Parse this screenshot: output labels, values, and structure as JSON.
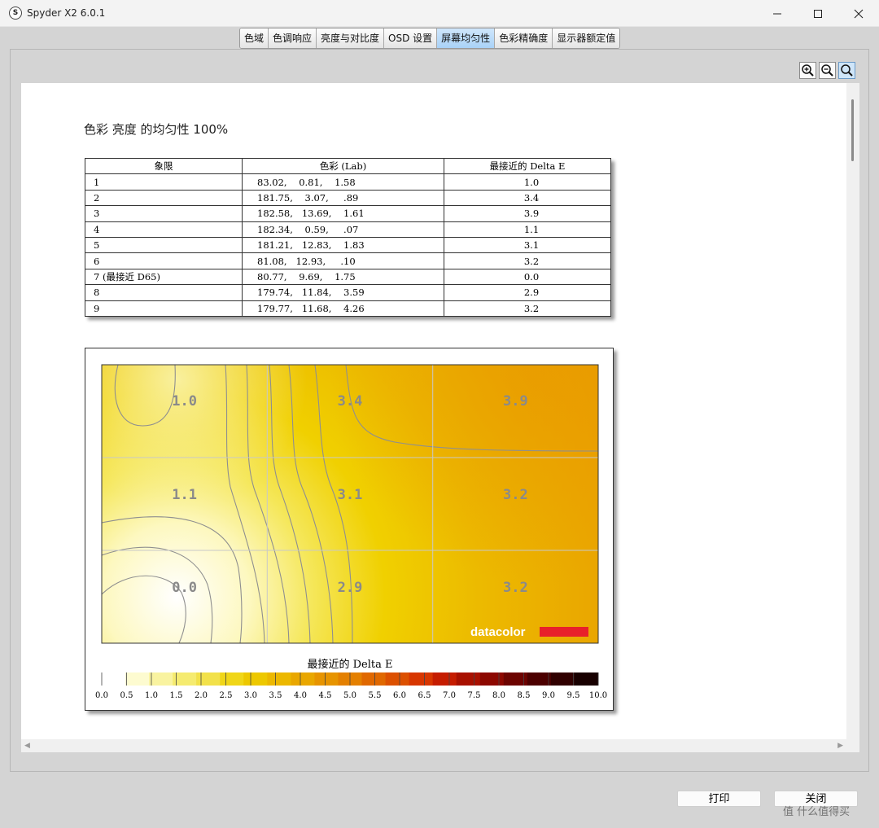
{
  "window": {
    "title": "Spyder X2 6.0.1",
    "app_icon_letter": "S"
  },
  "tabs": [
    {
      "label": "色域",
      "active": false
    },
    {
      "label": "色调响应",
      "active": false
    },
    {
      "label": "亮度与对比度",
      "active": false
    },
    {
      "label": "OSD 设置",
      "active": false
    },
    {
      "label": "屏幕均匀性",
      "active": true
    },
    {
      "label": "色彩精确度",
      "active": false
    },
    {
      "label": "显示器额定值",
      "active": false
    }
  ],
  "zoom": [
    "zoom-in-icon",
    "zoom-out-icon",
    "zoom-fit-icon"
  ],
  "report": {
    "title": "色彩 亮度 的均匀性 100%",
    "table": {
      "headers": [
        "象限",
        "色彩 (Lab)",
        "最接近的 Delta E"
      ],
      "rows": [
        {
          "quadrant": "1",
          "lab": "83.02,    0.81,    1.58",
          "delta_e": "1.0"
        },
        {
          "quadrant": "2",
          "lab": "181.75,    3.07,     .89",
          "delta_e": "3.4"
        },
        {
          "quadrant": "3",
          "lab": "182.58,   13.69,    1.61",
          "delta_e": "3.9"
        },
        {
          "quadrant": "4",
          "lab": "182.34,    0.59,     .07",
          "delta_e": "1.1"
        },
        {
          "quadrant": "5",
          "lab": "181.21,   12.83,    1.83",
          "delta_e": "3.1"
        },
        {
          "quadrant": "6",
          "lab": "81.08,   12.93,     .10",
          "delta_e": "3.2"
        },
        {
          "quadrant": "7 (最接近 D65)",
          "lab": "80.77,    9.69,    1.75",
          "delta_e": "0.0"
        },
        {
          "quadrant": "8",
          "lab": "179.74,   11.84,    3.59",
          "delta_e": "2.9"
        },
        {
          "quadrant": "9",
          "lab": "179.77,   11.68,    4.26",
          "delta_e": "3.2"
        }
      ]
    }
  },
  "chart_data": {
    "type": "heatmap",
    "grid": [
      [
        1.0,
        3.4,
        3.9
      ],
      [
        1.1,
        3.1,
        3.2
      ],
      [
        0.0,
        2.9,
        3.2
      ]
    ],
    "cell_labels": [
      [
        "1.0",
        "3.4",
        "3.9"
      ],
      [
        "1.1",
        "3.1",
        "3.2"
      ],
      [
        "0.0",
        "2.9",
        "3.2"
      ]
    ],
    "scale_title": "最接近的 Delta E",
    "scale_range": [
      0,
      10
    ],
    "scale_ticks": [
      "0.0",
      "0.5",
      "1.0",
      "1.5",
      "2.0",
      "2.5",
      "3.0",
      "3.5",
      "4.0",
      "4.5",
      "5.0",
      "5.5",
      "6.0",
      "6.5",
      "7.0",
      "7.5",
      "8.0",
      "8.5",
      "9.0",
      "9.5",
      "10.0"
    ],
    "scale_colors": [
      "#ffffff",
      "#fdfbd0",
      "#f9f3a0",
      "#f5eb70",
      "#f2e14a",
      "#f0d618",
      "#edc800",
      "#ecb800",
      "#e9a700",
      "#e79400",
      "#e48000",
      "#e06800",
      "#dc5000",
      "#d73600",
      "#c51c00",
      "#a81000",
      "#8c0800",
      "#6c0300",
      "#4c0000",
      "#300000",
      "#180000"
    ],
    "brand": "datacolor",
    "brand_color": "#e8202a",
    "gridlines": true
  },
  "buttons": {
    "print": "打印",
    "close": "关闭"
  },
  "watermark": "值 什么值得买"
}
